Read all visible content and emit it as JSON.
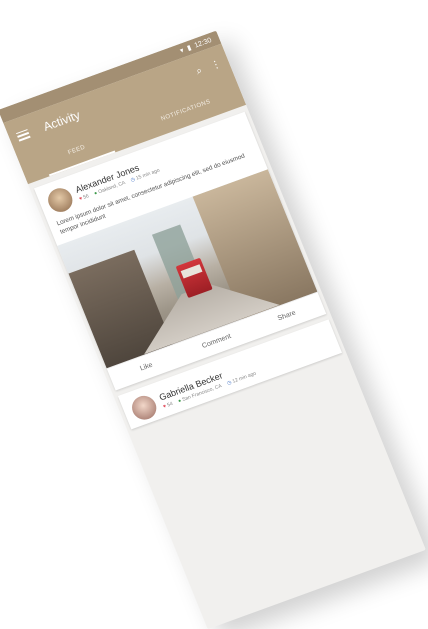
{
  "status": {
    "time": "12:30"
  },
  "appbar": {
    "title": "Activity"
  },
  "tabs": [
    {
      "label": "FEED",
      "active": true
    },
    {
      "label": "NOTIFICATIONS",
      "active": false
    }
  ],
  "colors": {
    "appbar": "#b9a586",
    "statusbar": "#a38f73"
  },
  "posts": [
    {
      "author": "Alexander Jones",
      "likes": "56",
      "location": "Oakland, CA",
      "time": "15 min ago",
      "text": "Lorem ipsum dolor sit amet, consectetur adipiscing elit, sed do eiusmod tempor incididunt",
      "actions": {
        "like": "Like",
        "comment": "Comment",
        "share": "Share"
      }
    },
    {
      "author": "Gabriella Becker",
      "likes": "54",
      "location": "San Francisco, CA",
      "time": "12 min ago"
    }
  ]
}
